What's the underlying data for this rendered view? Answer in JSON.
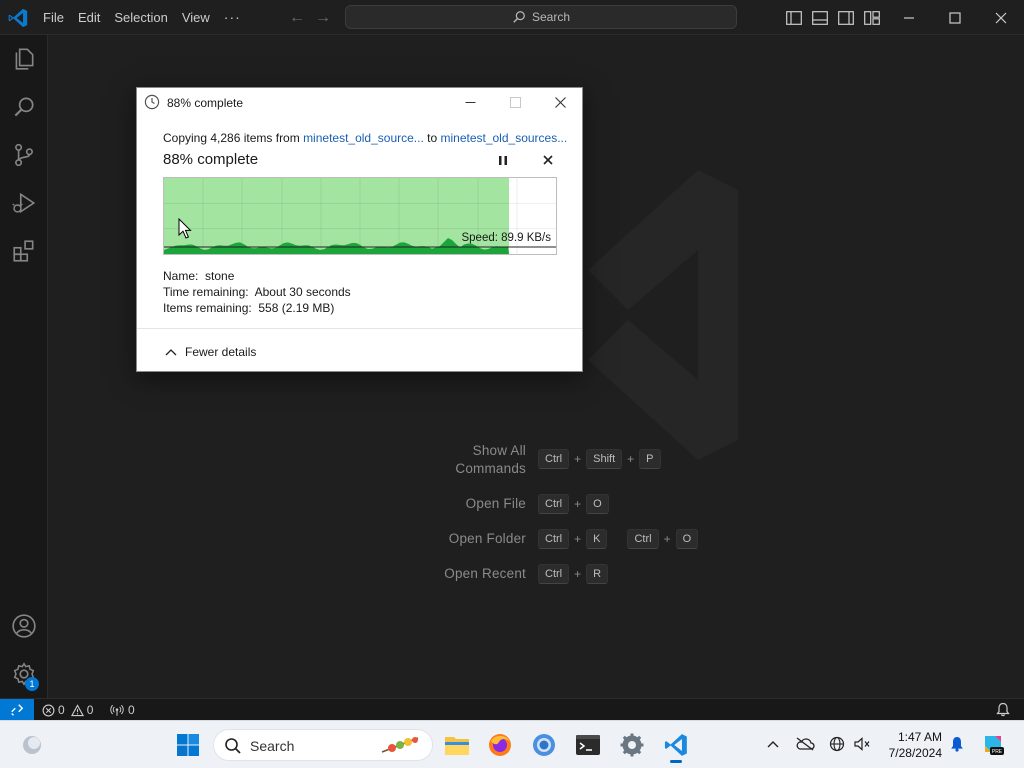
{
  "titlebar": {
    "menu": [
      "File",
      "Edit",
      "Selection",
      "View",
      "···"
    ],
    "search_label": "Search",
    "accent": "#0078d4"
  },
  "activitybar": {
    "items": [
      "explorer-icon",
      "search-icon",
      "source-control-icon",
      "run-debug-icon",
      "extensions-icon"
    ],
    "bottom": [
      "accounts-icon",
      "manage-gear-icon"
    ],
    "manage_badge": "1"
  },
  "welcome": {
    "shortcuts": [
      {
        "label_line1": "Show All",
        "label_line2": "Commands",
        "keys": [
          [
            "Ctrl",
            "Shift",
            "P"
          ]
        ]
      },
      {
        "label_line1": "Open File",
        "keys": [
          [
            "Ctrl",
            "O"
          ]
        ]
      },
      {
        "label_line1": "Open Folder",
        "keys": [
          [
            "Ctrl",
            "K"
          ],
          [
            "Ctrl",
            "O"
          ]
        ]
      },
      {
        "label_line1": "Open Recent",
        "keys": [
          [
            "Ctrl",
            "R"
          ]
        ]
      }
    ],
    "plus": "+"
  },
  "dialog": {
    "title": "88% complete",
    "copying_prefix": "Copying 4,286 items from ",
    "source": "minetest_old_source...",
    "to_word": " to ",
    "destination": "minetest_old_sources...",
    "percent_label": "88% complete",
    "progress_fraction": 0.88,
    "speed": "Speed: 89.9 KB/s",
    "name_label": "Name:",
    "name_value": "stone",
    "time_label": "Time remaining:",
    "time_value": "About 30 seconds",
    "items_label": "Items remaining:",
    "items_value": "558 (2.19 MB)",
    "fewer_details": "Fewer details",
    "progress_color": "#a3e4a0",
    "graph_color": "#1ca53a"
  },
  "statusbar": {
    "errors": "0",
    "warnings": "0",
    "ports": "0"
  },
  "taskbar": {
    "search_label": "Search",
    "apps": [
      "file-explorer-icon",
      "firefox-icon",
      "chrome-icon",
      "terminal-icon",
      "settings-icon",
      "vscode-icon"
    ],
    "time": "1:47 AM",
    "date": "7/28/2024"
  }
}
